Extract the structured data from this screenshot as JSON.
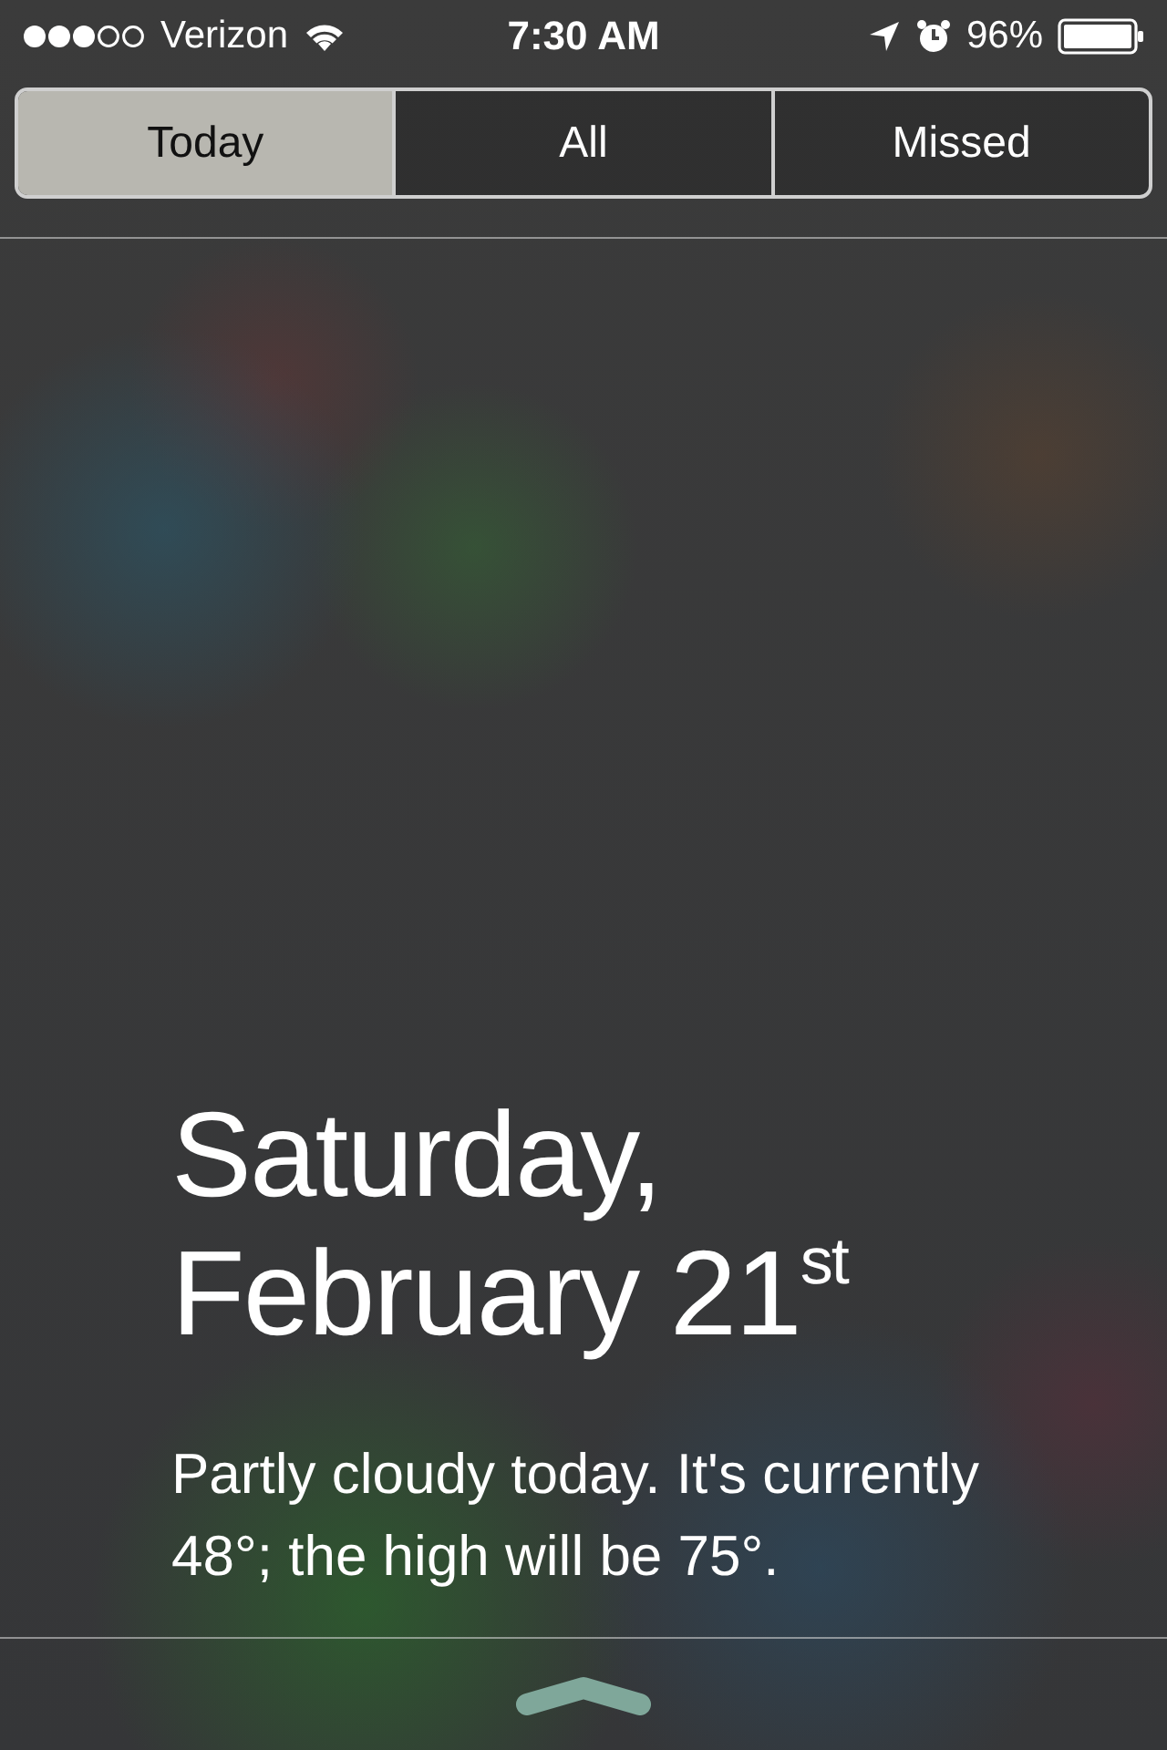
{
  "status_bar": {
    "carrier": "Verizon",
    "time": "7:30 AM",
    "battery": "96%"
  },
  "tabs": [
    {
      "label": "Today",
      "selected": true
    },
    {
      "label": "All",
      "selected": false
    },
    {
      "label": "Missed",
      "selected": false
    }
  ],
  "date_lines": [
    "Saturday,",
    "February 21$^{st}$"
  ],
  "summary": "Partly cloudy today. It's currently 48°; the high will be 75°."
}
